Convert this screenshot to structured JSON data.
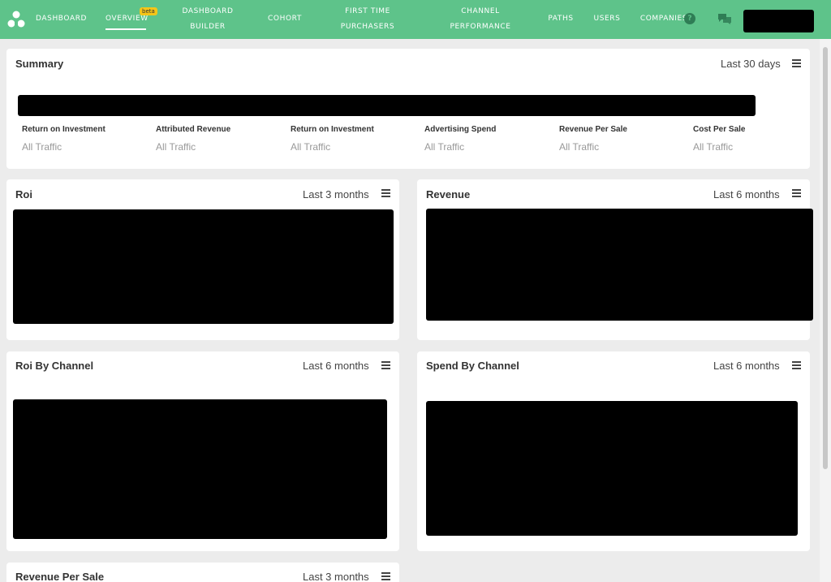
{
  "nav": {
    "items": [
      {
        "label": "DASHBOARD"
      },
      {
        "label": "OVERVIEW"
      },
      {
        "label": "DASHBOARD BUILDER"
      },
      {
        "label": "COHORT"
      },
      {
        "label": "FIRST TIME PURCHASERS"
      },
      {
        "label": "CHANNEL PERFORMANCE"
      },
      {
        "label": "PATHS"
      },
      {
        "label": "USERS"
      },
      {
        "label": "COMPANIES"
      }
    ],
    "badge": "beta",
    "help_symbol": "?",
    "icons": {
      "logo": "app-logo-icon",
      "help": "help-icon",
      "chat": "chat-icon"
    },
    "accent_color": "#5ec38a"
  },
  "summary": {
    "title": "Summary",
    "range": "Last 30 days",
    "metrics": [
      {
        "label": "Return on Investment",
        "sub": "All Traffic"
      },
      {
        "label": "Attributed Revenue",
        "sub": "All Traffic"
      },
      {
        "label": "Return on Investment",
        "sub": "All Traffic"
      },
      {
        "label": "Advertising Spend",
        "sub": "All Traffic"
      },
      {
        "label": "Revenue Per Sale",
        "sub": "All Traffic"
      },
      {
        "label": "Cost Per Sale",
        "sub": "All Traffic"
      }
    ]
  },
  "panels": {
    "roi": {
      "title": "Roi",
      "range": "Last 3 months"
    },
    "revenue": {
      "title": "Revenue",
      "range": "Last 6 months"
    },
    "roi_by_channel": {
      "title": "Roi By Channel",
      "range": "Last 6 months"
    },
    "spend_by_channel": {
      "title": "Spend By Channel",
      "range": "Last 6 months"
    },
    "revenue_per_sale": {
      "title": "Revenue Per Sale",
      "range": "Last 3 months"
    }
  }
}
